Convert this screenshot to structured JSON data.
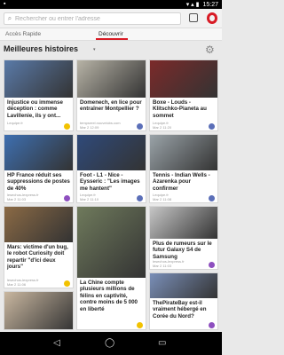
{
  "status": {
    "time": "15:27",
    "icons": "▾ ▴ ▮"
  },
  "address_bar": {
    "placeholder": "Rechercher ou entrer l'adresse",
    "search_icon": "search-icon",
    "tabs_icon": "tabs-icon",
    "menu_icon": "opera-logo-icon"
  },
  "tabs": [
    {
      "label": "Accès Rapide"
    },
    {
      "label": "Découvrir"
    }
  ],
  "header": {
    "title": "Meilleures histoires",
    "dropdown": "▾",
    "gear": "⚙"
  },
  "cards": [
    {
      "text": "Injustice ou immense déception : comme Lavillenie, ils y ont...",
      "source": "Lequipe.fr",
      "date": "",
      "badge_color": "#f2c200",
      "image_color": "#5a7aa8"
    },
    {
      "text": "Domenech, en lice pour entraîner Montpellier ?",
      "source": "tempsreel.nouvelobs.com",
      "date": "Mar 2 12:09",
      "badge_color": "#5b6fb8",
      "image_color": "#b7b3a6"
    },
    {
      "text": "Boxe - Louds - Klitschko-Pianeta au sommet",
      "source": "Lequipe.fr",
      "date": "Mar 2 11:20",
      "badge_color": "#5b6fb8",
      "image_color": "#7b2a2a"
    },
    {
      "text": "HP France réduit ses suppressions de postes de 40%",
      "source": "lesechos-lexpress.fr",
      "date": "Mar 2 11:03",
      "badge_color": "#8e4fbf",
      "image_color": "#3e6fb0"
    },
    {
      "text": "Foot - L1 - Nice - Eysseric : \"Les images me hantent\"",
      "source": "Lequipe.fr",
      "date": "Mar 2 11:10",
      "badge_color": "#5b6fb8",
      "image_color": "#2f4a7a"
    },
    {
      "text": "Tennis - Indian Wells - Azarenka pour confirmer",
      "source": "Lequipe.fr",
      "date": "Mar 2 11:08",
      "badge_color": "#5b6fb8",
      "image_color": "#9aa3a8"
    },
    {
      "text": "Mars: victime d'un bug, le robot Curiosity doit repartir \"d'ici deux jours\"",
      "source": "lesechos-lexpress.fr",
      "date": "Mar 2 11:06",
      "badge_color": "#f2c200",
      "image_color": "#8b6a45"
    },
    {
      "text": "La Chine compte plusieurs millions de félins en captivité, contre moins de 5 000 en liberté",
      "source": "",
      "date": "",
      "badge_color": "#f2c200",
      "image_color": "#6f7a5c"
    },
    {
      "text": "Plus de rumeurs sur le futur Galaxy S4 de Samsung",
      "source": "lesechos-lexpress.fr",
      "date": "Mar 2 11:03",
      "badge_color": "#8e4fbf",
      "image_color": "#c6c6c6"
    },
    {
      "text": "ThePirateBay est-il vraiment hébergé en Corée du Nord?",
      "source": "",
      "date": "",
      "badge_color": "#8e4fbf",
      "image_color": "#7a8fb8"
    },
    {
      "text": "",
      "source": "",
      "date": "",
      "badge_color": "",
      "image_color": "#c9b7a0"
    }
  ],
  "navbar": {
    "back": "◁",
    "home": "◯",
    "recent": "▭"
  }
}
